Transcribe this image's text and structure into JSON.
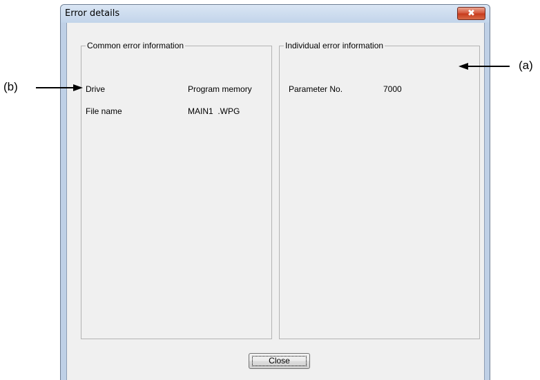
{
  "window": {
    "title": "Error details",
    "close_glyph": "✖"
  },
  "common_group": {
    "title": "Common error information",
    "rows": [
      {
        "label": "Drive",
        "value": "Program memory"
      },
      {
        "label": "File name",
        "value": "MAIN1  .WPG"
      }
    ]
  },
  "individual_group": {
    "title": "Individual error information",
    "rows": [
      {
        "label": "Parameter No.",
        "value": "7000"
      }
    ]
  },
  "buttons": {
    "close": "Close"
  },
  "callouts": {
    "a": "(a)",
    "b": "(b)"
  }
}
